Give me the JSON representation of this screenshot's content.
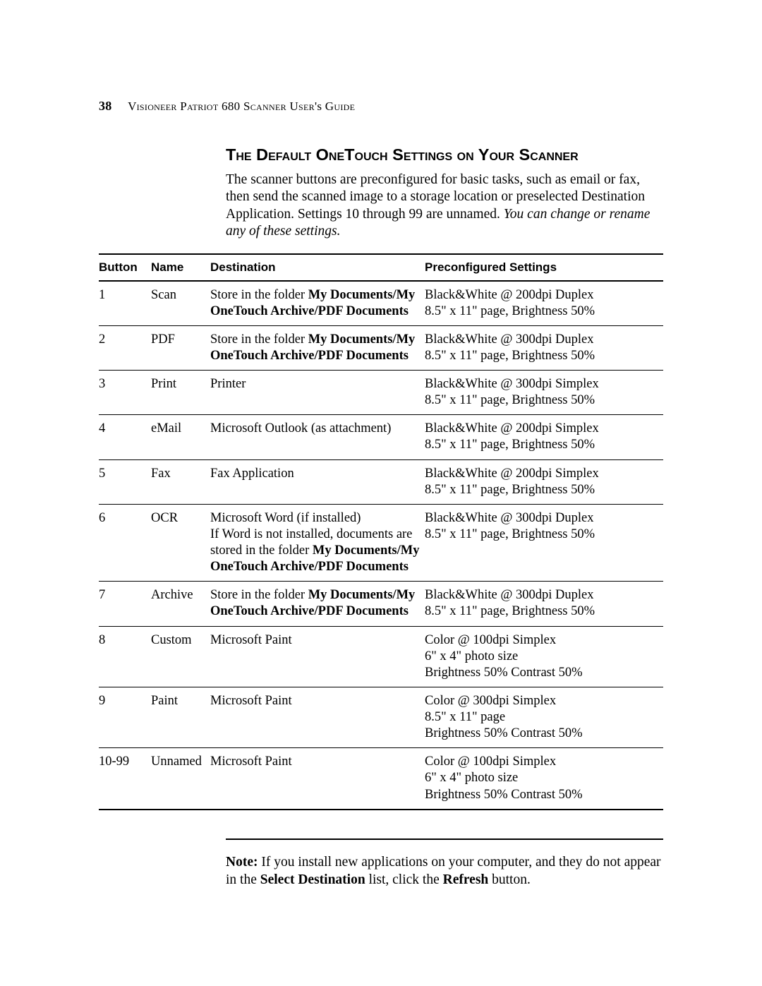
{
  "header": {
    "page_number": "38",
    "running_title_1": "V",
    "running_title_2": "isioneer",
    "running_title_3": " P",
    "running_title_4": "atriot",
    "running_title_5": " 680 S",
    "running_title_6": "canner",
    "running_title_7": " U",
    "running_title_8": "ser",
    "running_title_9": "'s G",
    "running_title_10": "uide"
  },
  "section_title": "The Default OneTouch Settings on Your Scanner",
  "intro_1": "The scanner buttons are preconfigured for basic tasks, such as email or fax, then send the scanned image to a storage location or preselected Destination Application. Settings 10 through 99 are unnamed. ",
  "intro_2_italic": "You can change or rename any of these settings.",
  "columns": {
    "button": "Button",
    "name": "Name",
    "destination": "Destination",
    "settings": "Preconfigured Settings"
  },
  "rows": [
    {
      "button": "1",
      "name": "Scan",
      "dest_pre": "Store in the folder ",
      "dest_bold": "My Documents/My OneTouch Archive/PDF Documents",
      "dest_post": "",
      "settings_l1": "Black&White @ 200dpi Duplex",
      "settings_l2": "8.5\" x 11\" page, Brightness 50%"
    },
    {
      "button": "2",
      "name": "PDF",
      "dest_pre": "Store in the folder ",
      "dest_bold": "My Documents/My OneTouch Archive/PDF Documents",
      "dest_post": "",
      "settings_l1": "Black&White @ 300dpi Duplex",
      "settings_l2": "8.5\" x 11\" page, Brightness 50%"
    },
    {
      "button": "3",
      "name": "Print",
      "dest_pre": "Printer",
      "dest_bold": "",
      "dest_post": "",
      "settings_l1": "Black&White @ 300dpi Simplex",
      "settings_l2": "8.5\" x 11\" page, Brightness 50%"
    },
    {
      "button": "4",
      "name": "eMail",
      "dest_pre": "Microsoft Outlook (as attachment)",
      "dest_bold": "",
      "dest_post": "",
      "settings_l1": "Black&White @ 200dpi Simplex",
      "settings_l2": "8.5\" x 11\" page, Brightness 50%"
    },
    {
      "button": "5",
      "name": "Fax",
      "dest_pre": "Fax Application",
      "dest_bold": "",
      "dest_post": "",
      "settings_l1": "Black&White @ 200dpi Simplex",
      "settings_l2": "8.5\" x 11\" page, Brightness 50%"
    },
    {
      "button": "6",
      "name": "OCR",
      "dest_pre": "Microsoft Word (if installed)\nIf Word is not installed, documents are stored in the folder ",
      "dest_bold": "My Documents/My OneTouch Archive/PDF Documents",
      "dest_post": "",
      "settings_l1": "Black&White @ 300dpi Duplex",
      "settings_l2": "8.5\" x 11\" page, Brightness 50%"
    },
    {
      "button": "7",
      "name": "Archive",
      "dest_pre": "Store in the folder ",
      "dest_bold": "My Documents/My OneTouch Archive/PDF Documents",
      "dest_post": "",
      "settings_l1": "Black&White @ 300dpi Duplex",
      "settings_l2": "8.5\" x 11\" page, Brightness 50%"
    },
    {
      "button": "8",
      "name": "Custom",
      "dest_pre": "Microsoft Paint",
      "dest_bold": "",
      "dest_post": "",
      "settings_l1": "Color @ 100dpi Simplex",
      "settings_l2": "6\" x 4\" photo size",
      "settings_l3": "Brightness 50% Contrast 50%"
    },
    {
      "button": "9",
      "name": "Paint",
      "dest_pre": "Microsoft Paint",
      "dest_bold": "",
      "dest_post": "",
      "settings_l1": "Color @ 300dpi Simplex",
      "settings_l2": "8.5\" x 11\" page",
      "settings_l3": "Brightness 50% Contrast 50%"
    },
    {
      "button": "10-99",
      "name": "Unnamed",
      "dest_pre": "Microsoft Paint",
      "dest_bold": "",
      "dest_post": "",
      "settings_l1": "Color @ 100dpi Simplex",
      "settings_l2": "6\" x 4\" photo size",
      "settings_l3": "Brightness 50% Contrast 50%"
    }
  ],
  "note": {
    "label": "Note:",
    "t1": " If you install new applications on your computer, and they do not appear in the ",
    "b1": "Select Destination",
    "t2": " list, click the ",
    "b2": "Refresh",
    "t3": " button."
  }
}
